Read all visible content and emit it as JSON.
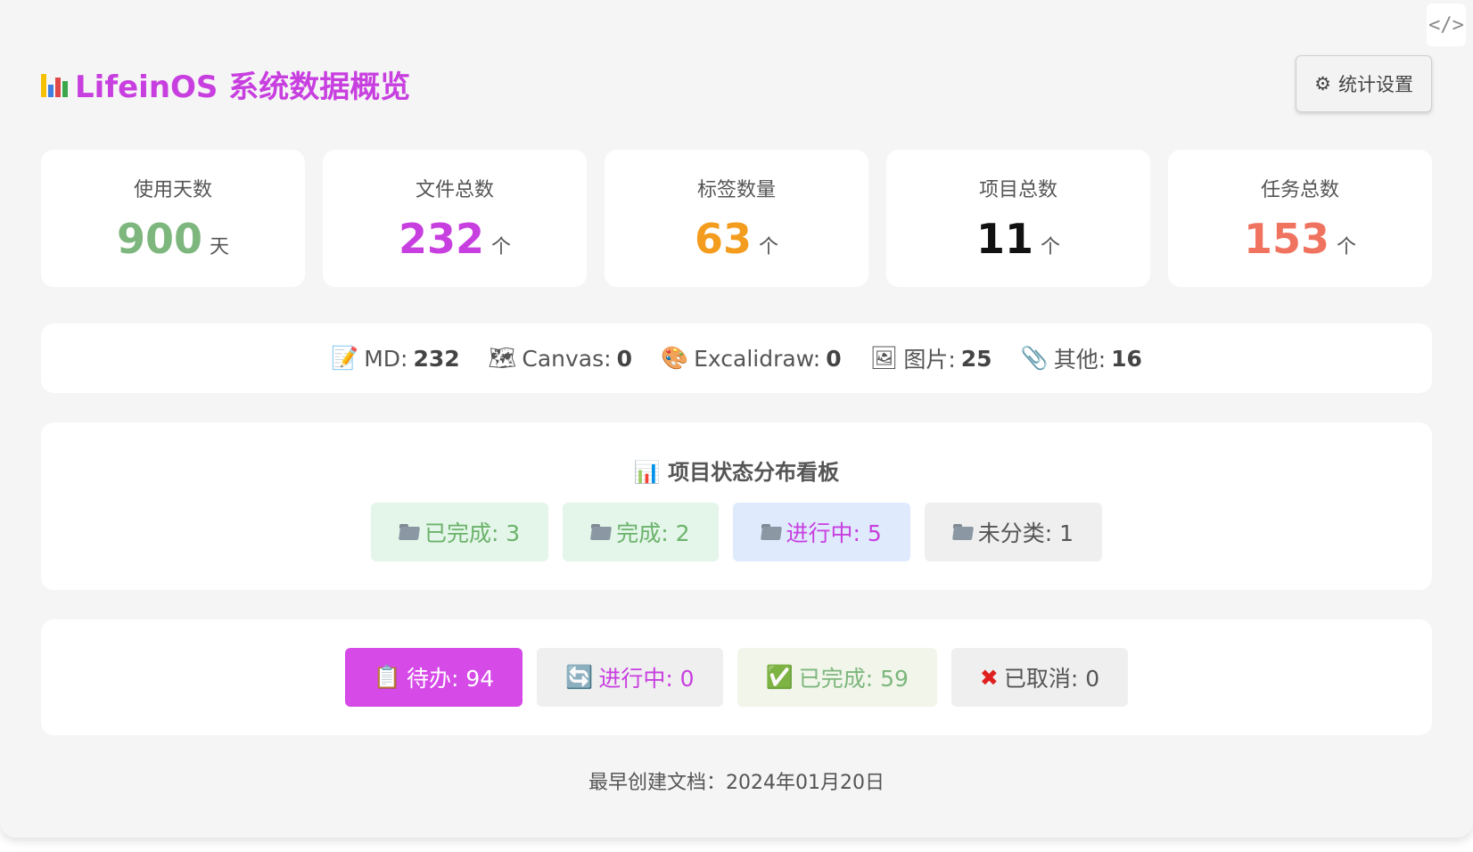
{
  "header": {
    "title": "LifeinOS 系统数据概览",
    "settings_label": "统计设置",
    "code_toggle": "</>"
  },
  "stats": [
    {
      "label": "使用天数",
      "value": "900",
      "unit": "天",
      "color": "#7db77d"
    },
    {
      "label": "文件总数",
      "value": "232",
      "unit": "个",
      "color": "#c83fe0"
    },
    {
      "label": "标签数量",
      "value": "63",
      "unit": "个",
      "color": "#f39c1e"
    },
    {
      "label": "项目总数",
      "value": "11",
      "unit": "个",
      "color": "#111111"
    },
    {
      "label": "任务总数",
      "value": "153",
      "unit": "个",
      "color": "#f07360"
    }
  ],
  "file_types": [
    {
      "icon": "memo-icon",
      "label": "MD:",
      "value": "232"
    },
    {
      "icon": "map-icon",
      "label": "Canvas:",
      "value": "0"
    },
    {
      "icon": "palette-icon",
      "label": "Excalidraw:",
      "value": "0"
    },
    {
      "icon": "picture-icon",
      "label": "图片:",
      "value": "25"
    },
    {
      "icon": "paperclip-icon",
      "label": "其他:",
      "value": "16"
    }
  ],
  "project_board": {
    "title": "项目状态分布看板",
    "statuses": [
      {
        "label": "已完成: 3",
        "bg": "#e4f5e9",
        "color": "#6bb36b"
      },
      {
        "label": "完成: 2",
        "bg": "#e4f5e9",
        "color": "#6bb36b"
      },
      {
        "label": "进行中: 5",
        "bg": "#dfeafd",
        "color": "#c83fe0"
      },
      {
        "label": "未分类: 1",
        "bg": "#efefef",
        "color": "#555555"
      }
    ]
  },
  "task_filters": [
    {
      "icon": "clipboard-icon",
      "label": "待办: 94",
      "bg": "#d64ae8",
      "color": "#ffffff",
      "active": true
    },
    {
      "icon": "refresh-icon",
      "label": "进行中: 0",
      "bg": "#efefef",
      "color": "#c83fe0",
      "active": false
    },
    {
      "icon": "check-icon",
      "label": "已完成: 59",
      "bg": "#f1f5ea",
      "color": "#7db77d",
      "active": false
    },
    {
      "icon": "cross-icon",
      "label": "已取消: 0",
      "bg": "#efefef",
      "color": "#555555",
      "active": false
    }
  ],
  "footer": {
    "earliest_doc": "最早创建文档：2024年01月20日"
  }
}
